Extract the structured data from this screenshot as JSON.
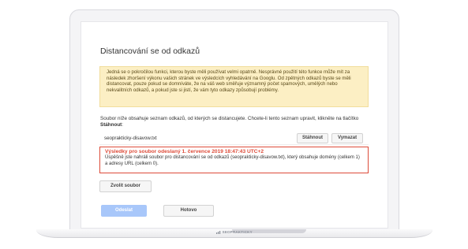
{
  "dialog": {
    "title": "Distancování se od odkazů",
    "warning": "Jedná se o pokročilou funkci, kterou byste měli používat velmi opatrně. Nesprávné použití této funkce může mít za následek zhoršení výkonu vašich stránek ve výsledcích vyhledávání na Googlu. Od zpětných odkazů byste se měli distancovat, pouze pokud se domníváte, že na váš web směřuje významný počet spamových, umělých nebo nekvalitních odkazů, a pokud jste si jistí, že vám tyto odkazy způsobují problémy.",
    "description_text": "Soubor níže obsahuje seznam odkazů, od kterých se distancujete. Chcete-li tento seznam upravit, klikněte na tlačítko",
    "description_bold": "Stáhnout",
    "file_name": "seoprakticky-disavow.txt",
    "download_label": "Stáhnout",
    "reject_label": "Vymazat",
    "result_title": "Výsledky pro soubor odeslaný 1. července 2019 18:47:43 UTC+2",
    "result_text": "Úspěšně jste nahráli soubor pro distancování se od odkazů (seoprakticky-disavow.txt), který obsahuje domény (celkem 1) a adresy URL (celkem 0).",
    "choose_file_label": "Zvolit soubor",
    "submit_label": "Odeslat",
    "done_label": "Hotovo"
  },
  "laptop": {
    "brand_text": "SEOPRAKTICKY"
  },
  "colors": {
    "warning_bg": "#fcefc4",
    "error_red": "#dd4b39",
    "submit_disabled": "#a8c7fa"
  }
}
